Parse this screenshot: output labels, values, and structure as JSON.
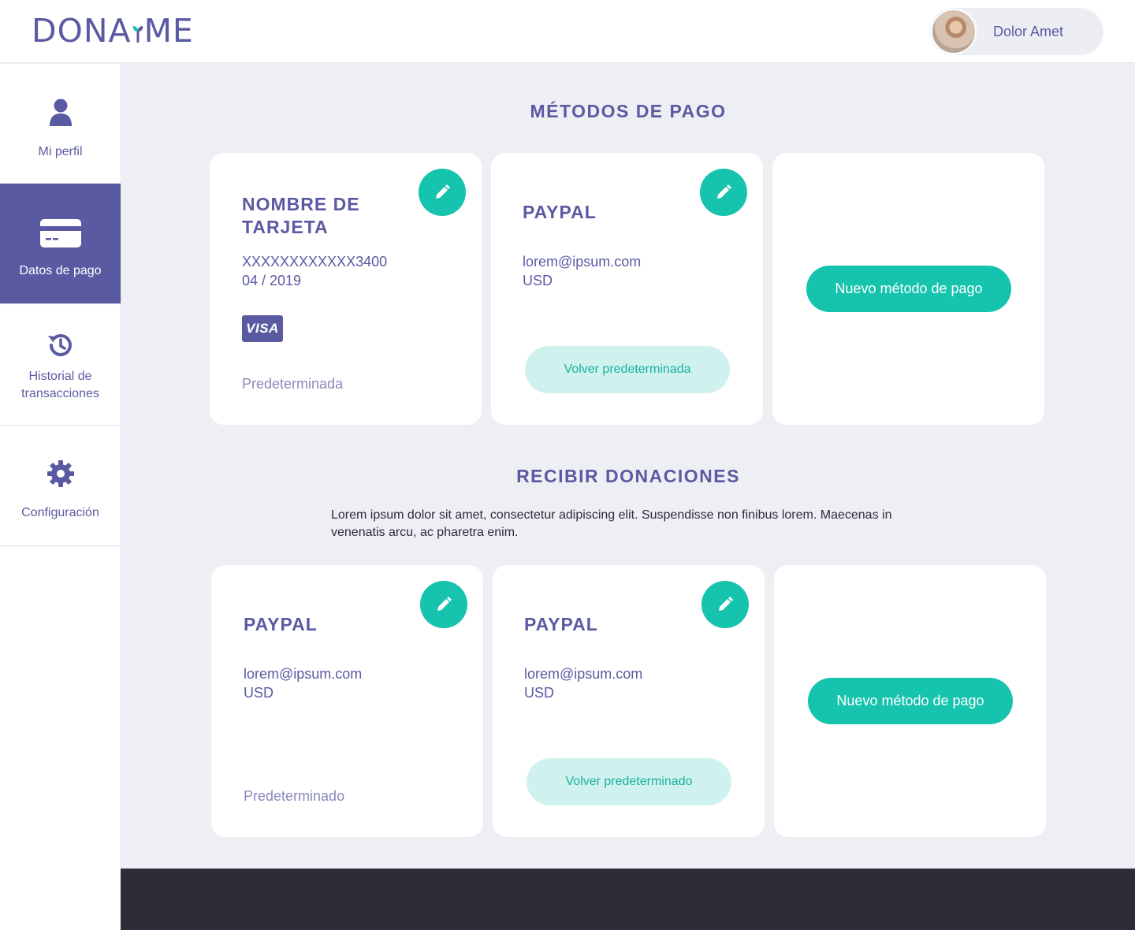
{
  "brand": {
    "name_left": "DONA",
    "name_right": "ME",
    "accent": "#16c3ad",
    "primary": "#5a5aa3"
  },
  "user": {
    "name": "Dolor Amet",
    "avatar_icon": "user-avatar-photo"
  },
  "sidebar": {
    "items": [
      {
        "label": "Mi perfil",
        "icon": "user-icon"
      },
      {
        "label": "Datos de pago",
        "icon": "credit-card-icon",
        "active": true
      },
      {
        "label": "Historial de transacciones",
        "icon": "history-icon"
      },
      {
        "label": "Configuración",
        "icon": "gear-icon"
      }
    ]
  },
  "payment_methods": {
    "title": "MÉTODOS DE PAGO",
    "cards": [
      {
        "title": "NOMBRE DE TARJETA",
        "number": "XXXXXXXXXXXX3400",
        "expiry": "04 / 2019",
        "brand": "VISA",
        "status": "Predeterminada"
      },
      {
        "title": "PAYPAL",
        "email": "lorem@ipsum.com",
        "currency": "USD",
        "action": "Volver predeterminada"
      }
    ],
    "new_button": "Nuevo método de pago"
  },
  "receive": {
    "title": "RECIBIR DONACIONES",
    "description": "Lorem ipsum dolor sit amet, consectetur adipiscing elit. Suspendisse non finibus lorem. Maecenas in venenatis arcu, ac pharetra enim.",
    "cards": [
      {
        "title": "PAYPAL",
        "email": "lorem@ipsum.com",
        "currency": "USD",
        "status": "Predeterminado"
      },
      {
        "title": "PAYPAL",
        "email": "lorem@ipsum.com",
        "currency": "USD",
        "action": "Volver predeterminado"
      }
    ],
    "new_button": "Nuevo método de pago"
  }
}
